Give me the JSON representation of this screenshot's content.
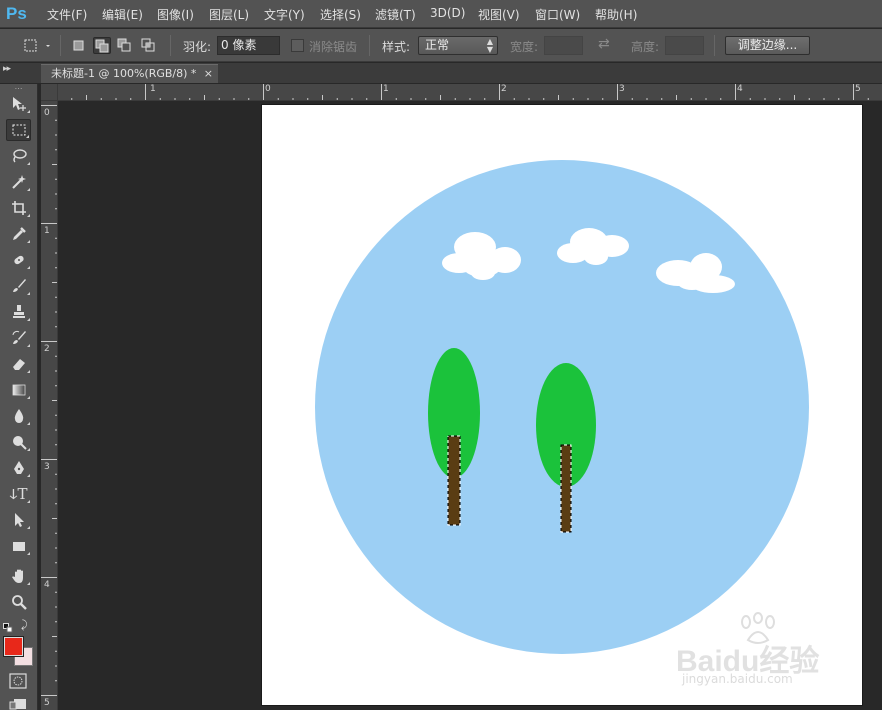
{
  "app": {
    "logo": "Ps"
  },
  "menu": [
    "文件(F)",
    "编辑(E)",
    "图像(I)",
    "图层(L)",
    "文字(Y)",
    "选择(S)",
    "滤镜(T)",
    "3D(D)",
    "视图(V)",
    "窗口(W)",
    "帮助(H)"
  ],
  "options": {
    "feather_label": "羽化:",
    "feather_value": "0 像素",
    "antialias_label": "消除锯齿",
    "style_label": "样式:",
    "style_value": "正常",
    "width_label": "宽度:",
    "height_label": "高度:",
    "refine_edge_button": "调整边缘..."
  },
  "tab": {
    "title": "未标题-1 @ 100%(RGB/8) *",
    "close": "×"
  },
  "rulers": {
    "horizontal": [
      "1",
      "0",
      "1",
      "2",
      "3",
      "4",
      "5"
    ],
    "vertical": [
      "0",
      "1",
      "2",
      "3",
      "4",
      "5"
    ]
  },
  "colors": {
    "sky": "#9ccff4",
    "foliage": "#1bc23b",
    "trunk": "#5a3d13",
    "foreground": "#e8281a",
    "background": "#f3dfe2"
  },
  "tools": [
    "move-icon",
    "marquee-icon",
    "lasso-icon",
    "magic-wand-icon",
    "crop-icon",
    "eyedropper-icon",
    "healing-brush-icon",
    "brush-icon",
    "clone-stamp-icon",
    "history-brush-icon",
    "eraser-icon",
    "gradient-icon",
    "blur-icon",
    "dodge-icon",
    "pen-icon",
    "type-icon",
    "path-selection-icon",
    "rectangle-icon",
    "hand-icon",
    "zoom-icon"
  ],
  "watermark": {
    "text": "Baidu经验",
    "sub": "jingyan.baidu.com"
  }
}
